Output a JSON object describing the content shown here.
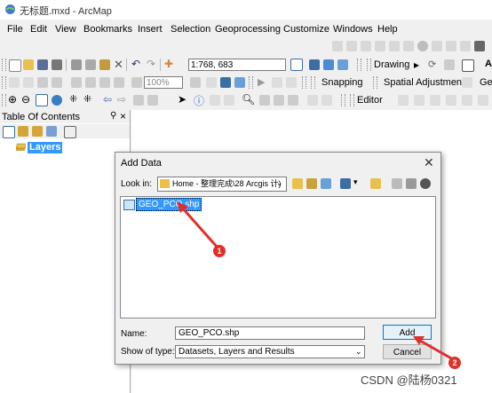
{
  "window": {
    "title": "无标题.mxd - ArcMap"
  },
  "menu": [
    "File",
    "Edit",
    "View",
    "Bookmarks",
    "Insert",
    "Selection",
    "Geoprocessing",
    "Customize",
    "Windows",
    "Help"
  ],
  "toolbar1": {
    "scale": "1:768, 683"
  },
  "toolbar2": {
    "zoom": "100%",
    "drawing_label": "Drawing",
    "snapping_label": "Snapping",
    "spatial_adjustment_label": "Spatial Adjustment",
    "ge_label": "Ge"
  },
  "toolbar3": {
    "editor_label": "Editor"
  },
  "toc": {
    "title": "Table Of Contents",
    "pin": "ᵖ",
    "close": "×",
    "layers_label": "Layers"
  },
  "dialog": {
    "title": "Add Data",
    "look_in_label": "Look in:",
    "look_in_value": "Home - 整理完成\\28 Arcgis 计)",
    "file_item": "GEO_PCO.shp",
    "name_label": "Name:",
    "name_value": "GEO_PCO.shp",
    "type_label": "Show of type:",
    "type_value": "Datasets, Layers and Results",
    "add_button": "Add",
    "cancel_button": "Cancel"
  },
  "annotations": [
    "1",
    "2"
  ],
  "watermark": "CSDN @陆杨0321",
  "colors": {
    "annotation": "#e0302a",
    "selection": "#3399ff"
  }
}
